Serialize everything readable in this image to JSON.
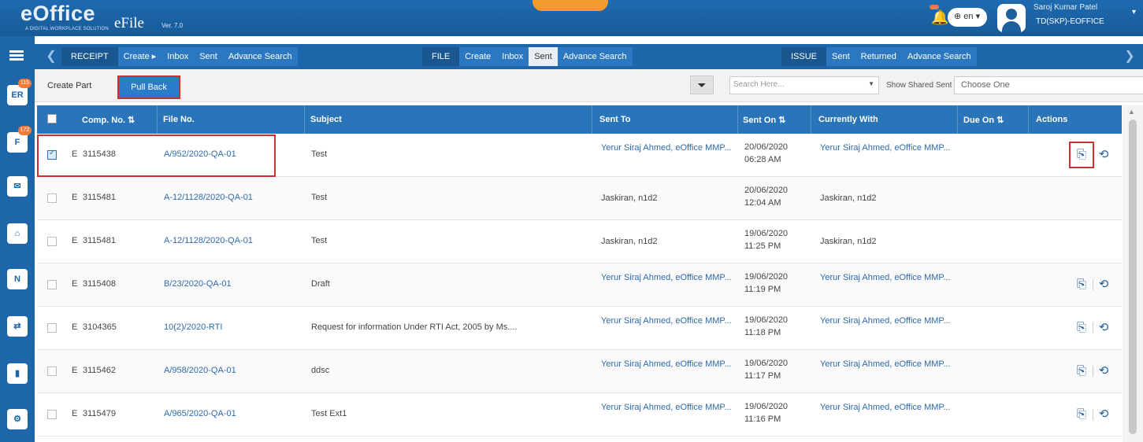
{
  "header": {
    "logo": "eOffice",
    "logo_tagline": "A DIGITAL WORKPLACE SOLUTION",
    "app_name": "eFile",
    "version": "Ver. 7.0",
    "language": "en",
    "user_name": "Saroj Kumar Patel",
    "user_org": "TD(SKP)-EOFFICE"
  },
  "sidebar": {
    "items": [
      {
        "icon": "receipt-register-icon",
        "label": "ER",
        "badge": "115"
      },
      {
        "icon": "file-register-icon",
        "label": "F",
        "badge": "172"
      },
      {
        "icon": "mail-icon",
        "label": "✉"
      },
      {
        "icon": "home-icon",
        "label": "⌂"
      },
      {
        "icon": "note-icon",
        "label": "N"
      },
      {
        "icon": "transfer-icon",
        "label": "⇄"
      },
      {
        "icon": "tools-icon",
        "label": "▮"
      },
      {
        "icon": "settings-icon",
        "label": "⚙"
      }
    ]
  },
  "nav": {
    "receipt": {
      "label": "RECEIPT",
      "links": [
        "Create ▸",
        "Inbox",
        "Sent",
        "Advance Search"
      ]
    },
    "file": {
      "label": "FILE",
      "links": [
        "Create",
        "Inbox",
        "Sent",
        "Advance Search"
      ],
      "active": "Sent"
    },
    "issue": {
      "label": "ISSUE",
      "links": [
        "Sent",
        "Returned",
        "Advance Search"
      ]
    }
  },
  "toolbar": {
    "create_part": "Create Part",
    "pull_back": "Pull Back",
    "search_placeholder": "Search Here...",
    "shared_label": "Show Shared Sent",
    "choose_value": "Choose One"
  },
  "table": {
    "headers": {
      "comp_no": "Comp. No. ⇅",
      "file_no": "File No.",
      "subject": "Subject",
      "sent_to": "Sent To",
      "sent_on": "Sent On ⇅",
      "currently_with": "Currently With",
      "due_on": "Due On ⇅",
      "actions": "Actions"
    },
    "rows": [
      {
        "type": "E",
        "comp": "3115438",
        "file": "A/952/2020-QA-01",
        "subject": "Test",
        "sent_to": "Yerur Siraj Ahmed, eOffice MMP...",
        "sent_to_link": true,
        "date": "20/06/2020",
        "time": "06:28 AM",
        "with": "Yerur Siraj Ahmed, eOffice MMP...",
        "with_link": true,
        "actions": true,
        "checked": true
      },
      {
        "type": "E",
        "comp": "3115481",
        "file": "A-12/1128/2020-QA-01",
        "subject": "Test",
        "sent_to": "Jaskiran, n1d2",
        "sent_to_link": false,
        "date": "20/06/2020",
        "time": "12:04 AM",
        "with": "Jaskiran, n1d2",
        "with_link": false,
        "actions": false,
        "checked": false
      },
      {
        "type": "E",
        "comp": "3115481",
        "file": "A-12/1128/2020-QA-01",
        "subject": "Test",
        "sent_to": "Jaskiran, n1d2",
        "sent_to_link": false,
        "date": "19/06/2020",
        "time": "11:25 PM",
        "with": "Jaskiran, n1d2",
        "with_link": false,
        "actions": false,
        "checked": false
      },
      {
        "type": "E",
        "comp": "3115408",
        "file": "B/23/2020-QA-01",
        "subject": "Draft",
        "sent_to": "Yerur Siraj Ahmed, eOffice MMP...",
        "sent_to_link": true,
        "date": "19/06/2020",
        "time": "11:19 PM",
        "with": "Yerur Siraj Ahmed, eOffice MMP...",
        "with_link": true,
        "actions": true,
        "checked": false
      },
      {
        "type": "E",
        "comp": "3104365",
        "file": "10(2)/2020-RTI",
        "subject": "Request for information Under RTI Act, 2005 by Ms....",
        "sent_to": "Yerur Siraj Ahmed, eOffice MMP...",
        "sent_to_link": true,
        "date": "19/06/2020",
        "time": "11:18 PM",
        "with": "Yerur Siraj Ahmed, eOffice MMP...",
        "with_link": true,
        "actions": true,
        "checked": false
      },
      {
        "type": "E",
        "comp": "3115462",
        "file": "A/958/2020-QA-01",
        "subject": "ddsc",
        "sent_to": "Yerur Siraj Ahmed, eOffice MMP...",
        "sent_to_link": true,
        "date": "19/06/2020",
        "time": "11:17 PM",
        "with": "Yerur Siraj Ahmed, eOffice MMP...",
        "with_link": true,
        "actions": true,
        "checked": false
      },
      {
        "type": "E",
        "comp": "3115479",
        "file": "A/965/2020-QA-01",
        "subject": "Test Ext1",
        "sent_to": "Yerur Siraj Ahmed, eOffice MMP...",
        "sent_to_link": true,
        "date": "19/06/2020",
        "time": "11:16 PM",
        "with": "Yerur Siraj Ahmed, eOffice MMP...",
        "with_link": true,
        "actions": true,
        "checked": false
      }
    ]
  },
  "colors": {
    "primary": "#1e66aa",
    "header_row": "#2a74b9",
    "highlight": "#cf2e2e",
    "link": "#2f6aa8",
    "badge": "#f07a3a"
  }
}
